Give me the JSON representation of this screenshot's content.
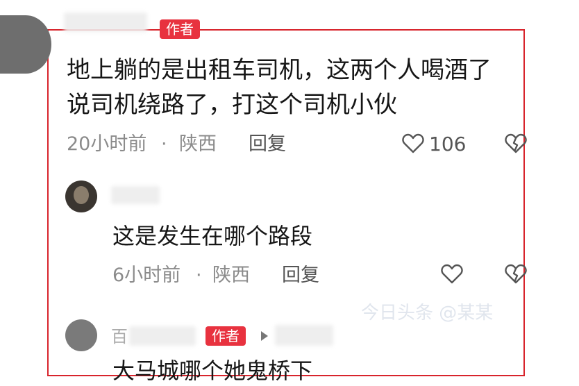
{
  "comment1": {
    "author_tag": "作者",
    "text_line1": "地上躺的是出租车司机，这两个人喝酒了",
    "text_line2": "说司机绕路了，打这个司机小伙",
    "time": "20小时前",
    "separator": "·",
    "location": "陕西",
    "reply_label": "回复",
    "like_count": "106",
    "icons": [
      "heart-icon",
      "broken-heart-icon"
    ]
  },
  "reply1": {
    "text": "这是发生在哪个路段",
    "time": "6小时前",
    "separator": "·",
    "location": "陕西",
    "reply_label": "回复",
    "icons": [
      "heart-icon",
      "broken-heart-icon"
    ]
  },
  "reply2": {
    "author_tag": "作者",
    "partial_name": "百",
    "text_partial": "大马城哪个她鬼桥下",
    "icons": [
      "reply-arrow-icon"
    ]
  },
  "watermark": "今日头条 @某某",
  "colors": {
    "frame": "#d8242c",
    "tag": "#e8323f",
    "meta": "#8b8b8b"
  }
}
